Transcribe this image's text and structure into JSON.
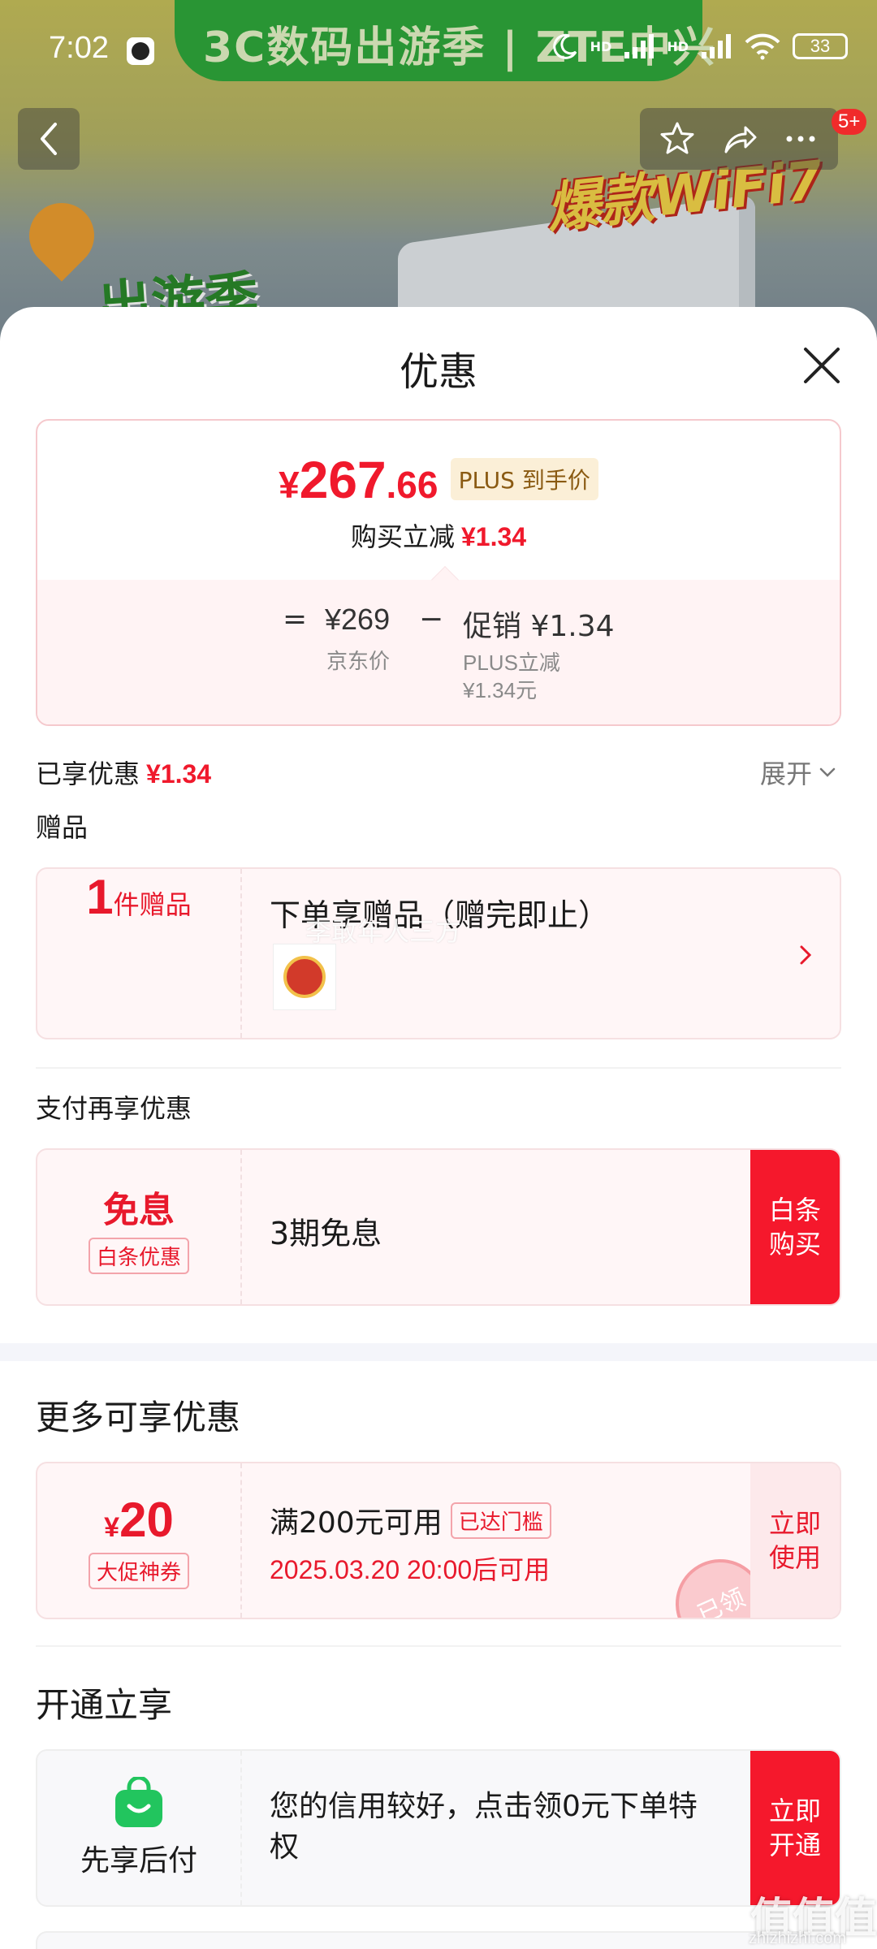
{
  "status_bar": {
    "time": "7:02",
    "battery": "33",
    "network_labels": [
      "HD",
      "HD"
    ]
  },
  "banner": {
    "promo_text": "3C数码出游季 | ZTE中兴",
    "wifi_text": "爆款WiFi7",
    "travel_text": "出游季",
    "cart_badge": "5+"
  },
  "sheet": {
    "title": "优惠"
  },
  "price_card": {
    "yen": "¥",
    "price_int": "267",
    "price_dec": ".66",
    "plus_tag": "PLUS 到手价",
    "buy_reduce_label": "购买立减",
    "buy_reduce_amount": "¥1.34",
    "equals": "=",
    "jd_price": "¥269",
    "jd_price_label": "京东价",
    "minus": "−",
    "promo_label": "促销 ¥1.34",
    "plus_reduce_label": "PLUS立减",
    "plus_reduce_amount": "¥1.34元"
  },
  "enjoyed": {
    "label": "已享优惠",
    "amount": "¥1.34",
    "expand_label": "展开"
  },
  "gift": {
    "section_label": "赠品",
    "count": "1",
    "count_unit": "件赠品",
    "title": "下单享赠品（赠完即止）",
    "overlay_text": "李敢年人三方"
  },
  "payment": {
    "section_label": "支付再享优惠",
    "left_title": "免息",
    "left_tag": "白条优惠",
    "desc": "3期免息",
    "cta": "白条购买"
  },
  "more": {
    "section_title": "更多可享优惠",
    "yen": "¥",
    "amount": "20",
    "coupon_tag": "大促神券",
    "condition": "满200元可用",
    "reached_tag": "已达门槛",
    "time_text": "2025.03.20 20:00后可用",
    "stamp": "已领",
    "cta": "立即使用"
  },
  "open": {
    "section_title": "开通立享",
    "left_label": "先享后付",
    "desc": "您的信用较好，点击领0元下单特权",
    "cta": "立即开通"
  },
  "watermark": {
    "main": "值值值",
    "sub": "zhizhizhi.com"
  },
  "colors": {
    "accent_red": "#f0192c",
    "cta_red": "#f5182c",
    "plus_gold": "#8a5a12",
    "green_icon": "#22c55e"
  }
}
